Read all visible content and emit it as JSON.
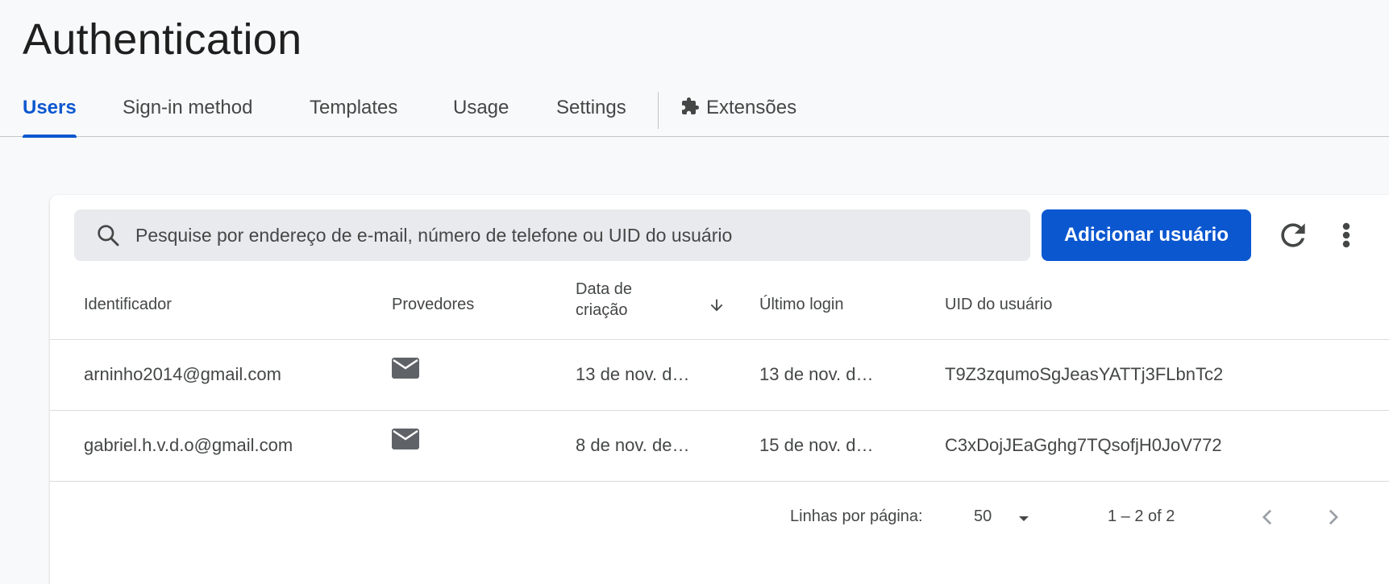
{
  "page": {
    "title": "Authentication"
  },
  "tabs": [
    {
      "label": "Users",
      "active": true
    },
    {
      "label": "Sign-in method"
    },
    {
      "label": "Templates"
    },
    {
      "label": "Usage"
    },
    {
      "label": "Settings"
    },
    {
      "label": "Extensões",
      "icon": "puzzle-icon"
    }
  ],
  "search": {
    "placeholder": "Pesquise por endereço de e-mail, número de telefone ou UID do usuário",
    "value": ""
  },
  "toolbar": {
    "add_user_label": "Adicionar usuário"
  },
  "table": {
    "columns": [
      {
        "label": "Identificador"
      },
      {
        "label": "Provedores"
      },
      {
        "label": "Data de criação",
        "sorted": "desc"
      },
      {
        "label": "Último login"
      },
      {
        "label": "UID do usuário"
      }
    ],
    "rows": [
      {
        "identifier": "arninho2014@gmail.com",
        "provider_icon": "email-icon",
        "created": "13 de nov. d…",
        "last_login": "13 de nov. d…",
        "uid": "T9Z3zqumoSgJeasYATTj3FLbnTc2"
      },
      {
        "identifier": "gabriel.h.v.d.o@gmail.com",
        "provider_icon": "email-icon",
        "created": "8 de nov. de…",
        "last_login": "15 de nov. d…",
        "uid": "C3xDojJEaGghg7TQsofjH0JoV772"
      }
    ]
  },
  "pagination": {
    "rows_per_page_label": "Linhas por página:",
    "rows_per_page": "50",
    "range": "1 – 2 of 2"
  },
  "colors": {
    "accent": "#0b57d0",
    "search_bg": "#e8eaed",
    "text_secondary": "#444746"
  }
}
